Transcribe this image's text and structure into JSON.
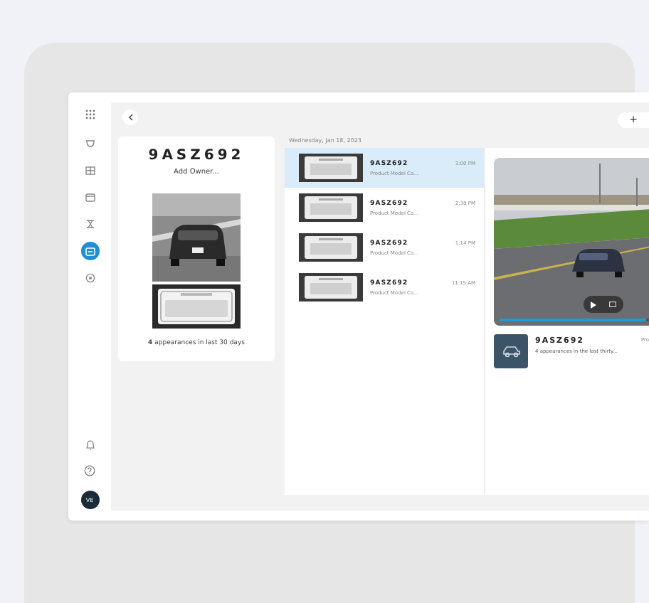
{
  "sidebar": {
    "items": [
      {
        "selected": false
      },
      {
        "selected": false
      },
      {
        "selected": false
      },
      {
        "selected": false
      },
      {
        "selected": true
      },
      {
        "selected": false
      }
    ],
    "avatar": "VE"
  },
  "profile": {
    "plate": "9ASZ692",
    "owner_link": "Add Owner...",
    "appearances": "**4** appearances in last 30 days"
  },
  "sightings": {
    "date": "Wednesday, Jan 18, 2023",
    "items": [
      {
        "plate": "9ASZ692",
        "subtitle": "Product Model Co...",
        "time": "3:00 PM",
        "selected": true
      },
      {
        "plate": "9ASZ692",
        "subtitle": "Product Model Co...",
        "time": "2:38 PM",
        "selected": false
      },
      {
        "plate": "9ASZ692",
        "subtitle": "Product Model Co...",
        "time": "1:14 PM",
        "selected": false
      },
      {
        "plate": "9ASZ692",
        "subtitle": "Product Model Co...",
        "time": "11:15 AM",
        "selected": false
      }
    ]
  },
  "detail": {
    "video": {
      "level": 0.97
    },
    "plate": "9ASZ692",
    "summary": "4 appearances in the last thirty...",
    "cut_label": "Pro",
    "add_button": "+"
  }
}
